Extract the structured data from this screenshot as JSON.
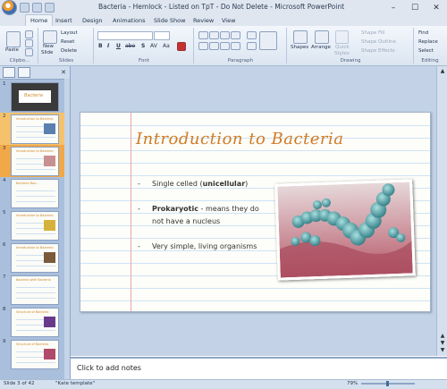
{
  "window": {
    "title": "Bacteria - Hemlock - Listed on TpT - Do Not Delete - Microsoft PowerPoint",
    "controls": [
      "–",
      "☐",
      "✕"
    ]
  },
  "tabs": [
    "Home",
    "Insert",
    "Design",
    "Animations",
    "Slide Show",
    "Review",
    "View"
  ],
  "ribbon": {
    "clipboard": {
      "paste": "Paste",
      "label": "Clipbo..."
    },
    "slides": {
      "new_slide": "New",
      "new_slide2": "Slide",
      "layout": "Layout",
      "reset": "Reset",
      "delete": "Delete",
      "label": "Slides"
    },
    "font": {
      "bold": "B",
      "italic": "I",
      "underline": "U",
      "strike": "abe",
      "shadow": "S",
      "spacing": "AV",
      "case": "Aa",
      "label": "Font"
    },
    "paragraph": {
      "label": "Paragraph"
    },
    "drawing": {
      "shapes": "Shapes",
      "arrange": "Arrange",
      "quick1": "Quick",
      "quick2": "Styles",
      "shape_fill": "Shape Fill",
      "shape_outline": "Shape Outline",
      "shape_effects": "Shape Effects",
      "label": "Drawing"
    },
    "editing": {
      "find": "Find",
      "replace": "Replace",
      "select": "Select",
      "label": "Editing"
    }
  },
  "thumbnails": [
    {
      "num": "1",
      "title": "Bacteria"
    },
    {
      "num": "2",
      "title": "Introduction to Bacteria"
    },
    {
      "num": "3",
      "title": "Introduction to Bacteria"
    },
    {
      "num": "4",
      "title": "Bacteria Bas..."
    },
    {
      "num": "5",
      "title": "Introduction to Bacteria"
    },
    {
      "num": "6",
      "title": "Introduction to Bacteria"
    },
    {
      "num": "7",
      "title": "Bacteria with Bacteria"
    },
    {
      "num": "8",
      "title": "Structure of Bacteria"
    },
    {
      "num": "9",
      "title": "Structure of Bacteria"
    }
  ],
  "slide": {
    "title": "Introduction to Bacteria",
    "bullets": [
      {
        "dash": "-",
        "text_pre": "Single celled (",
        "bold": "unicellular",
        "text_post": ")"
      },
      {
        "dash": "-",
        "text_pre": "",
        "bold": "Prokaryotic",
        "text_post": " - means they do"
      },
      {
        "dash": "",
        "text_pre": "not have a nucleus",
        "bold": "",
        "text_post": ""
      },
      {
        "dash": "-",
        "text_pre": "Very simple, living organisms",
        "bold": "",
        "text_post": ""
      }
    ]
  },
  "notes": {
    "placeholder": "Click to add notes"
  },
  "status": {
    "slide": "Slide 3 of 42",
    "template": "\"Kate template\"",
    "zoom": "79%"
  },
  "colors": {
    "title": "#d07a24",
    "accent": "#f5c26b",
    "ruled": "#cfe3f5",
    "margin": "#e8a6a6"
  }
}
